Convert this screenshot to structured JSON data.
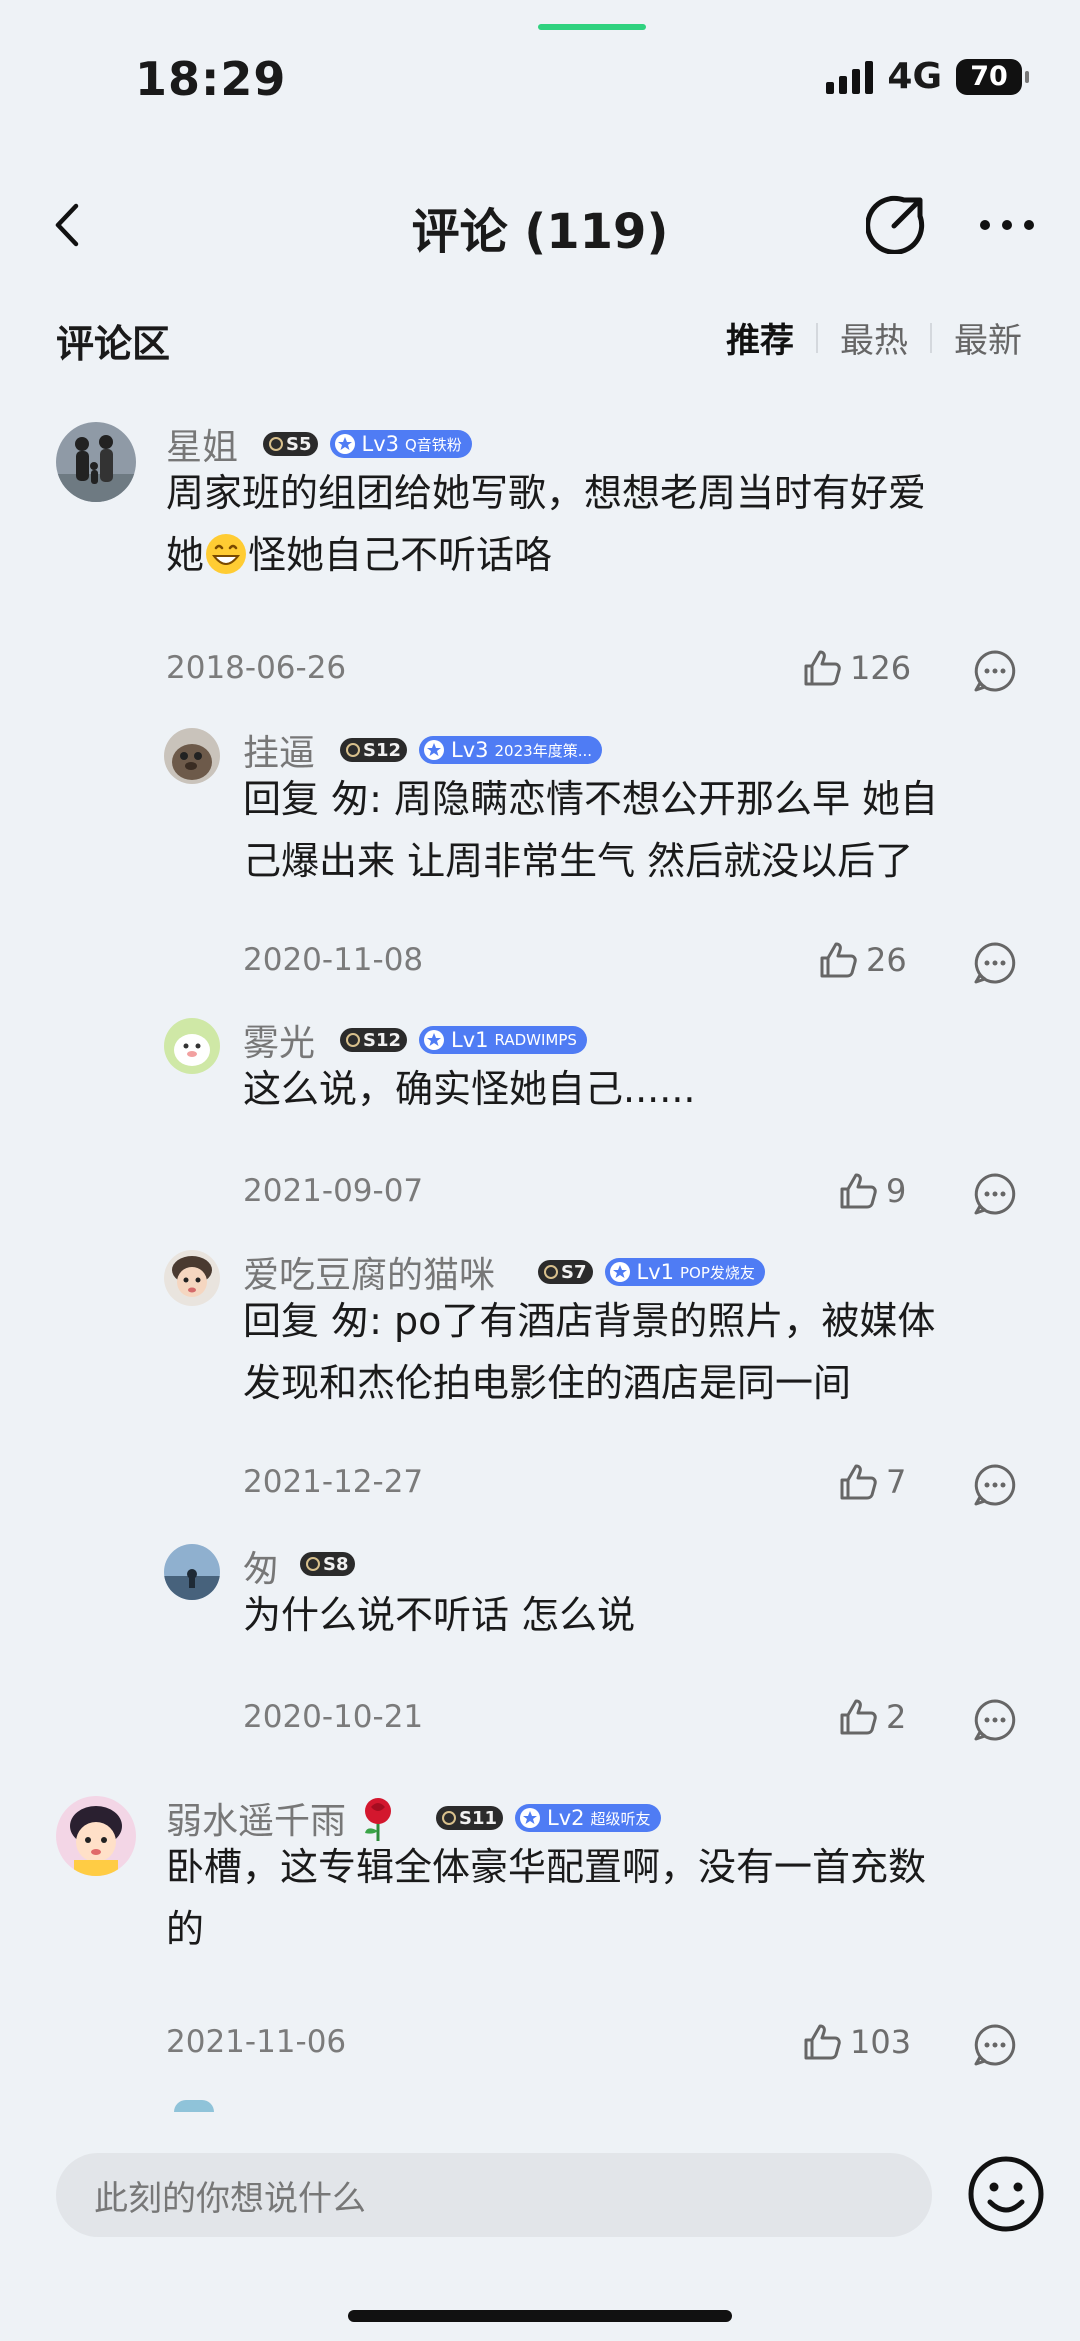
{
  "status": {
    "time": "18:29",
    "network": "4G",
    "battery": "70"
  },
  "nav": {
    "title": "评论 (119)"
  },
  "section": {
    "title": "评论区",
    "sort": [
      "推荐",
      "最热",
      "最新"
    ]
  },
  "comments": [
    {
      "user": "星姐",
      "svip": "S5",
      "lv": "Lv3",
      "tag": "Q音铁粉",
      "text_a": "周家班的组团给她写歌，想想老周当时有好爱",
      "text_b1": "她",
      "text_b2": "怪她自己不听话咯",
      "date": "2018-06-26",
      "likes": "126"
    },
    {
      "user": "挂逼",
      "svip": "S12",
      "lv": "Lv3",
      "tag": "2023年度策...",
      "reply_prefix": "回复 匆:",
      "text_a": " 周隐瞒恋情不想公开那么早 她自",
      "text_b": "己爆出来 让周非常生气 然后就没以后了",
      "date": "2020-11-08",
      "likes": "26"
    },
    {
      "user": "雾光",
      "svip": "S12",
      "lv": "Lv1",
      "tag": "RADWIMPS",
      "text_a": "这么说，确实怪她自己......",
      "date": "2021-09-07",
      "likes": "9"
    },
    {
      "user": "爱吃豆腐的猫咪",
      "svip": "S7",
      "lv": "Lv1",
      "tag": "POP发烧友",
      "reply_prefix": "回复 匆:",
      "text_a": " po了有酒店背景的照片，被媒体",
      "text_b": "发现和杰伦拍电影住的酒店是同一间",
      "date": "2021-12-27",
      "likes": "7"
    },
    {
      "user": "匆",
      "svip": "S8",
      "text_a": "为什么说不听话 怎么说",
      "date": "2020-10-21",
      "likes": "2"
    },
    {
      "user": "弱水遥千雨",
      "svip": "S11",
      "lv": "Lv2",
      "tag": "超级听友",
      "text_a": "卧槽，这专辑全体豪华配置啊，没有一首充数",
      "text_b": "的",
      "date": "2021-11-06",
      "likes": "103"
    }
  ],
  "input": {
    "placeholder": "此刻的你想说什么"
  },
  "colors": {
    "level_badge": "#4f7cf4",
    "svip_badge": "#2b2b2b",
    "accent_green": "#2fd27f"
  }
}
